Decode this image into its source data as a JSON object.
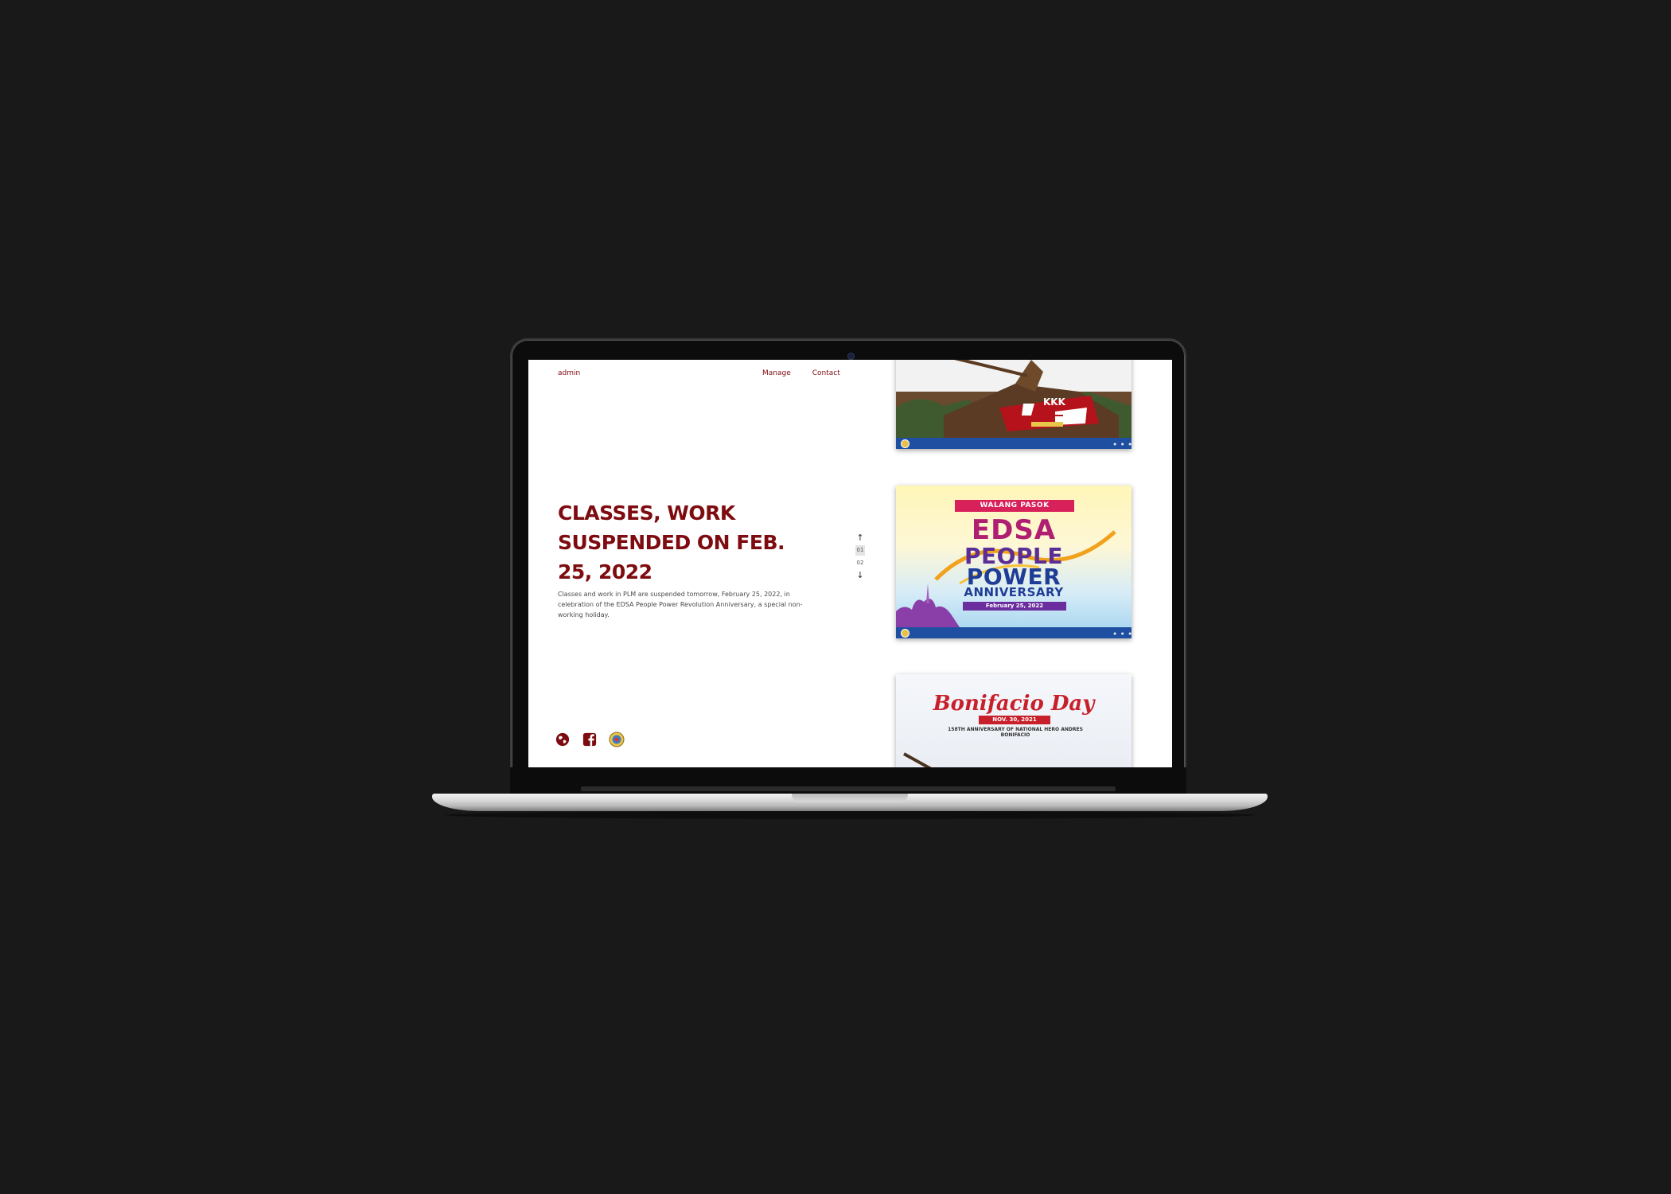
{
  "nav": {
    "admin_label": "admin",
    "links": [
      "Manage",
      "Contact"
    ]
  },
  "article": {
    "headline": "CLASSES, WORK SUSPENDED ON FEB. 25, 2022",
    "summary": "Classes and work in PLM are suspended tomorrow, February 25, 2022, in celebration of the EDSA People Power Revolution Anniversary, a special non-working holiday."
  },
  "pager": {
    "up_icon": "arrow-up-icon",
    "down_icon": "arrow-down-icon",
    "pages": [
      "01",
      "02"
    ],
    "active_page": "01"
  },
  "social": {
    "icons": [
      "globe-icon",
      "facebook-icon",
      "plm-seal-icon"
    ]
  },
  "cards": [
    {
      "kind": "monument-photo",
      "overlay_text": "KKK"
    },
    {
      "kind": "edsa-poster",
      "tag": "WALANG PASOK",
      "line1": "EDSA",
      "line2": "PEOPLE",
      "line3": "POWER",
      "line4": "ANNIVERSARY",
      "date": "February 25, 2022"
    },
    {
      "kind": "bonifacio-poster",
      "title": "Bonifacio Day",
      "date": "NOV. 30, 2021",
      "subtitle": "158TH ANNIVERSARY OF NATIONAL HERO ANDRES BONIFACIO"
    }
  ],
  "colors": {
    "accent": "#7d0b0f",
    "page_bg": "#191919",
    "footer_blue": "#1f4fa0"
  }
}
